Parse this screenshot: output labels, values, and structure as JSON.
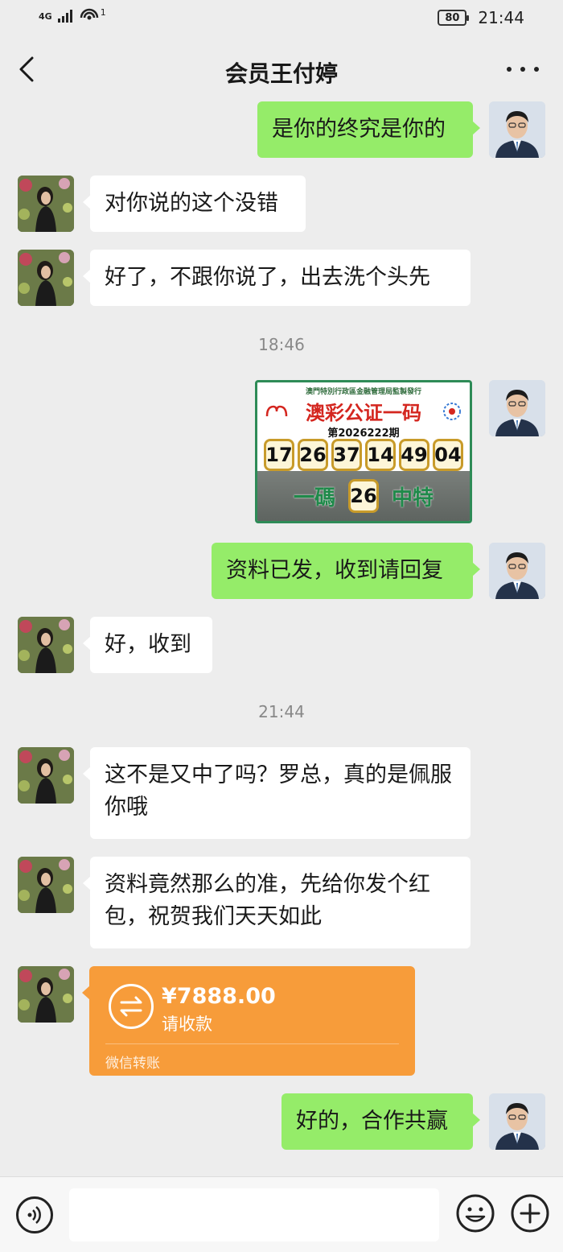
{
  "status_bar": {
    "network": "4G",
    "wifi_badge": "1",
    "battery": "80",
    "time": "21:44"
  },
  "header": {
    "title": "会员王付婷",
    "back_icon": "chevron-left-icon",
    "more_icon": "more-dots-icon"
  },
  "messages": {
    "m1": "是你的终究是你的",
    "m2": "对你说的这个没错",
    "m3": "好了，不跟你说了，出去洗个头先",
    "time1": "18:46",
    "lottery": {
      "issuer": "澳門特別行政區金融管理局監製發行",
      "title": "澳彩公证一码",
      "issue": "第2026222期",
      "numbers": [
        "17",
        "26",
        "37",
        "14",
        "49",
        "04"
      ],
      "bottom_left": "一碼",
      "special": "26",
      "bottom_right": "中特"
    },
    "m4": "资料已发，收到请回复",
    "m5": "好，收到",
    "time2": "21:44",
    "m6": "这不是又中了吗？罗总，真的是佩服你哦",
    "m7": "资料竟然那么的准，先给你发个红包，祝贺我们天天如此",
    "transfer": {
      "amount": "¥7888.00",
      "status": "请收款",
      "footer": "微信转账"
    },
    "m8": "好的，合作共赢"
  },
  "input_bar": {
    "voice_icon": "voice-icon",
    "emoji_icon": "emoji-icon",
    "plus_icon": "plus-icon",
    "input_value": ""
  },
  "colors": {
    "background": "#ededed",
    "bubble_out": "#95ec69",
    "bubble_in": "#ffffff",
    "transfer": "#f79c3a"
  }
}
